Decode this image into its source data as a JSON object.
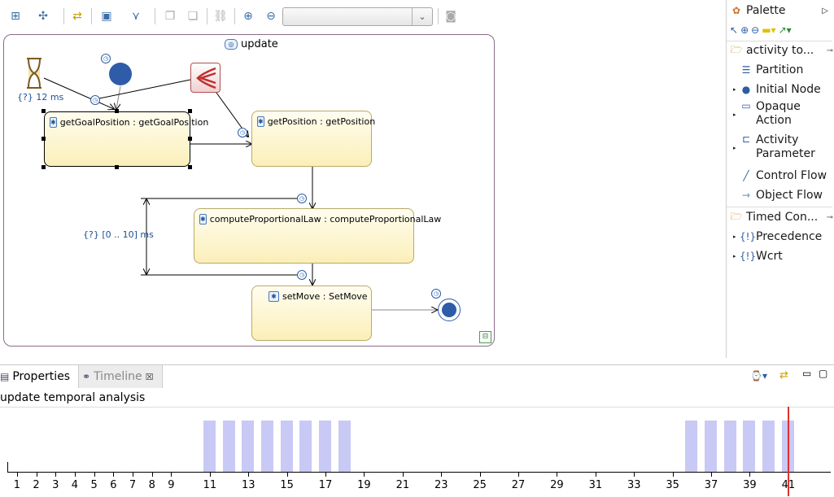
{
  "toolbar": {
    "zoom_value": "",
    "icons": [
      "layout-icon",
      "arrange-icon",
      "refresh-icon",
      "select-icon",
      "filter-icon",
      "copy-icon",
      "paste-icon",
      "link-icon",
      "zoom-in-icon",
      "zoom-out-icon",
      "camera-icon"
    ]
  },
  "diagram": {
    "title": "update",
    "timer_label": "{?} 12 ms",
    "constraint_label": "{?} [0 .. 10] ms",
    "actions": [
      {
        "label": "getGoalPosition : getGoalPosition"
      },
      {
        "label": "getPosition : getPosition"
      },
      {
        "label": "computeProportionalLaw : computeProportionalLaw"
      },
      {
        "label": "setMove : SetMove"
      }
    ]
  },
  "palette": {
    "title": "Palette",
    "groups": [
      {
        "label": "activity to...",
        "items": [
          "Partition",
          "Initial Node",
          "Opaque Action",
          "Activity Parameter",
          "Control Flow",
          "Object Flow"
        ]
      },
      {
        "label": "Timed Con...",
        "items": [
          "Precedence",
          "Wcrt"
        ]
      }
    ]
  },
  "bottom": {
    "tabs": [
      "Properties",
      "Timeline"
    ],
    "heading": "update temporal analysis",
    "timeline": {
      "ticks": [
        1,
        2,
        3,
        4,
        5,
        6,
        7,
        8,
        9,
        11,
        13,
        15,
        17,
        19,
        21,
        23,
        25,
        27,
        29,
        31,
        33,
        35,
        37,
        39,
        41
      ],
      "active_slots": [
        11,
        12,
        13,
        14,
        15,
        16,
        17,
        18,
        36,
        37,
        38,
        39,
        40,
        41
      ],
      "marker": 41
    }
  },
  "colors": {
    "bar": "#c9c9f5",
    "marker": "#e03030",
    "node": "#2e5ca8"
  }
}
